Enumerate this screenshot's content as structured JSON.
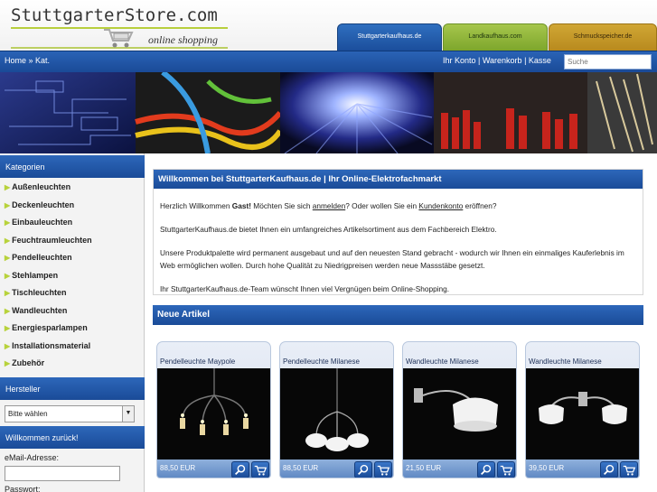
{
  "header": {
    "logo_title": "StuttgarterStore.com",
    "logo_subtitle": "online shopping",
    "tabs": [
      "Stuttgarterkaufhaus.de",
      "Landkaufhaus.com",
      "Schmuckspeicher.de"
    ]
  },
  "nav": {
    "breadcrumb": "Home » Kat.",
    "account_link": "Ihr Konto",
    "cart_link": "Warenkorb",
    "checkout_link": "Kasse",
    "search_placeholder": "Suche"
  },
  "sidebar": {
    "categories_title": "Kategorien",
    "categories": [
      "Außenleuchten",
      "Deckenleuchten",
      "Einbauleuchten",
      "Feuchtraumleuchten",
      "Pendelleuchten",
      "Stehlampen",
      "Tischleuchten",
      "Wandleuchten",
      "Energiesparlampen",
      "Installationsmaterial",
      "Zubehör"
    ],
    "manufacturer_title": "Hersteller",
    "manufacturer_selected": "Bitte wählen",
    "welcome_title": "Willkommen zurück!",
    "email_label": "eMail-Adresse:",
    "password_label": "Passwort:"
  },
  "welcome": {
    "title": "Willkommen bei StuttgarterKaufhaus.de | Ihr Online-Elektrofachmarkt",
    "greeting_1": "Herzlich Willkommen ",
    "greeting_guest": "Gast!",
    "greeting_2": " Möchten Sie sich ",
    "login_link": "anmelden",
    "greeting_3": "? Oder wollen Sie ein ",
    "account_link": "Kundenkonto",
    "greeting_4": " eröffnen?",
    "para_2": "StuttgarterKaufhaus.de bietet Ihnen ein umfangreiches Artikelsortiment aus dem Fachbereich Elektro.",
    "para_3": "Unsere Produktpalette wird permanent ausgebaut und auf den neuesten Stand gebracht - wodurch wir Ihnen ein einmaliges Kauferlebnis im Web ermöglichen wollen. Durch hohe Qualität zu Niedrigpreisen werden neue Massstäbe gesetzt.",
    "para_4": "Ihr StuttgarterKaufhaus.de-Team wünscht Ihnen viel Vergnügen beim Online-Shopping."
  },
  "new_products": {
    "title": "Neue Artikel",
    "items": [
      {
        "name": "Pendelleuchte Maypole",
        "price": "88,50 EUR"
      },
      {
        "name": "Pendelleuchte Milanese",
        "price": "88,50 EUR"
      },
      {
        "name": "Wandleuchte Milanese",
        "price": "21,50 EUR"
      },
      {
        "name": "Wandleuchte Milanese",
        "price": "39,50 EUR"
      }
    ]
  },
  "colors": {
    "brand_blue": "#1a4b98",
    "accent_green": "#b8d23b"
  }
}
